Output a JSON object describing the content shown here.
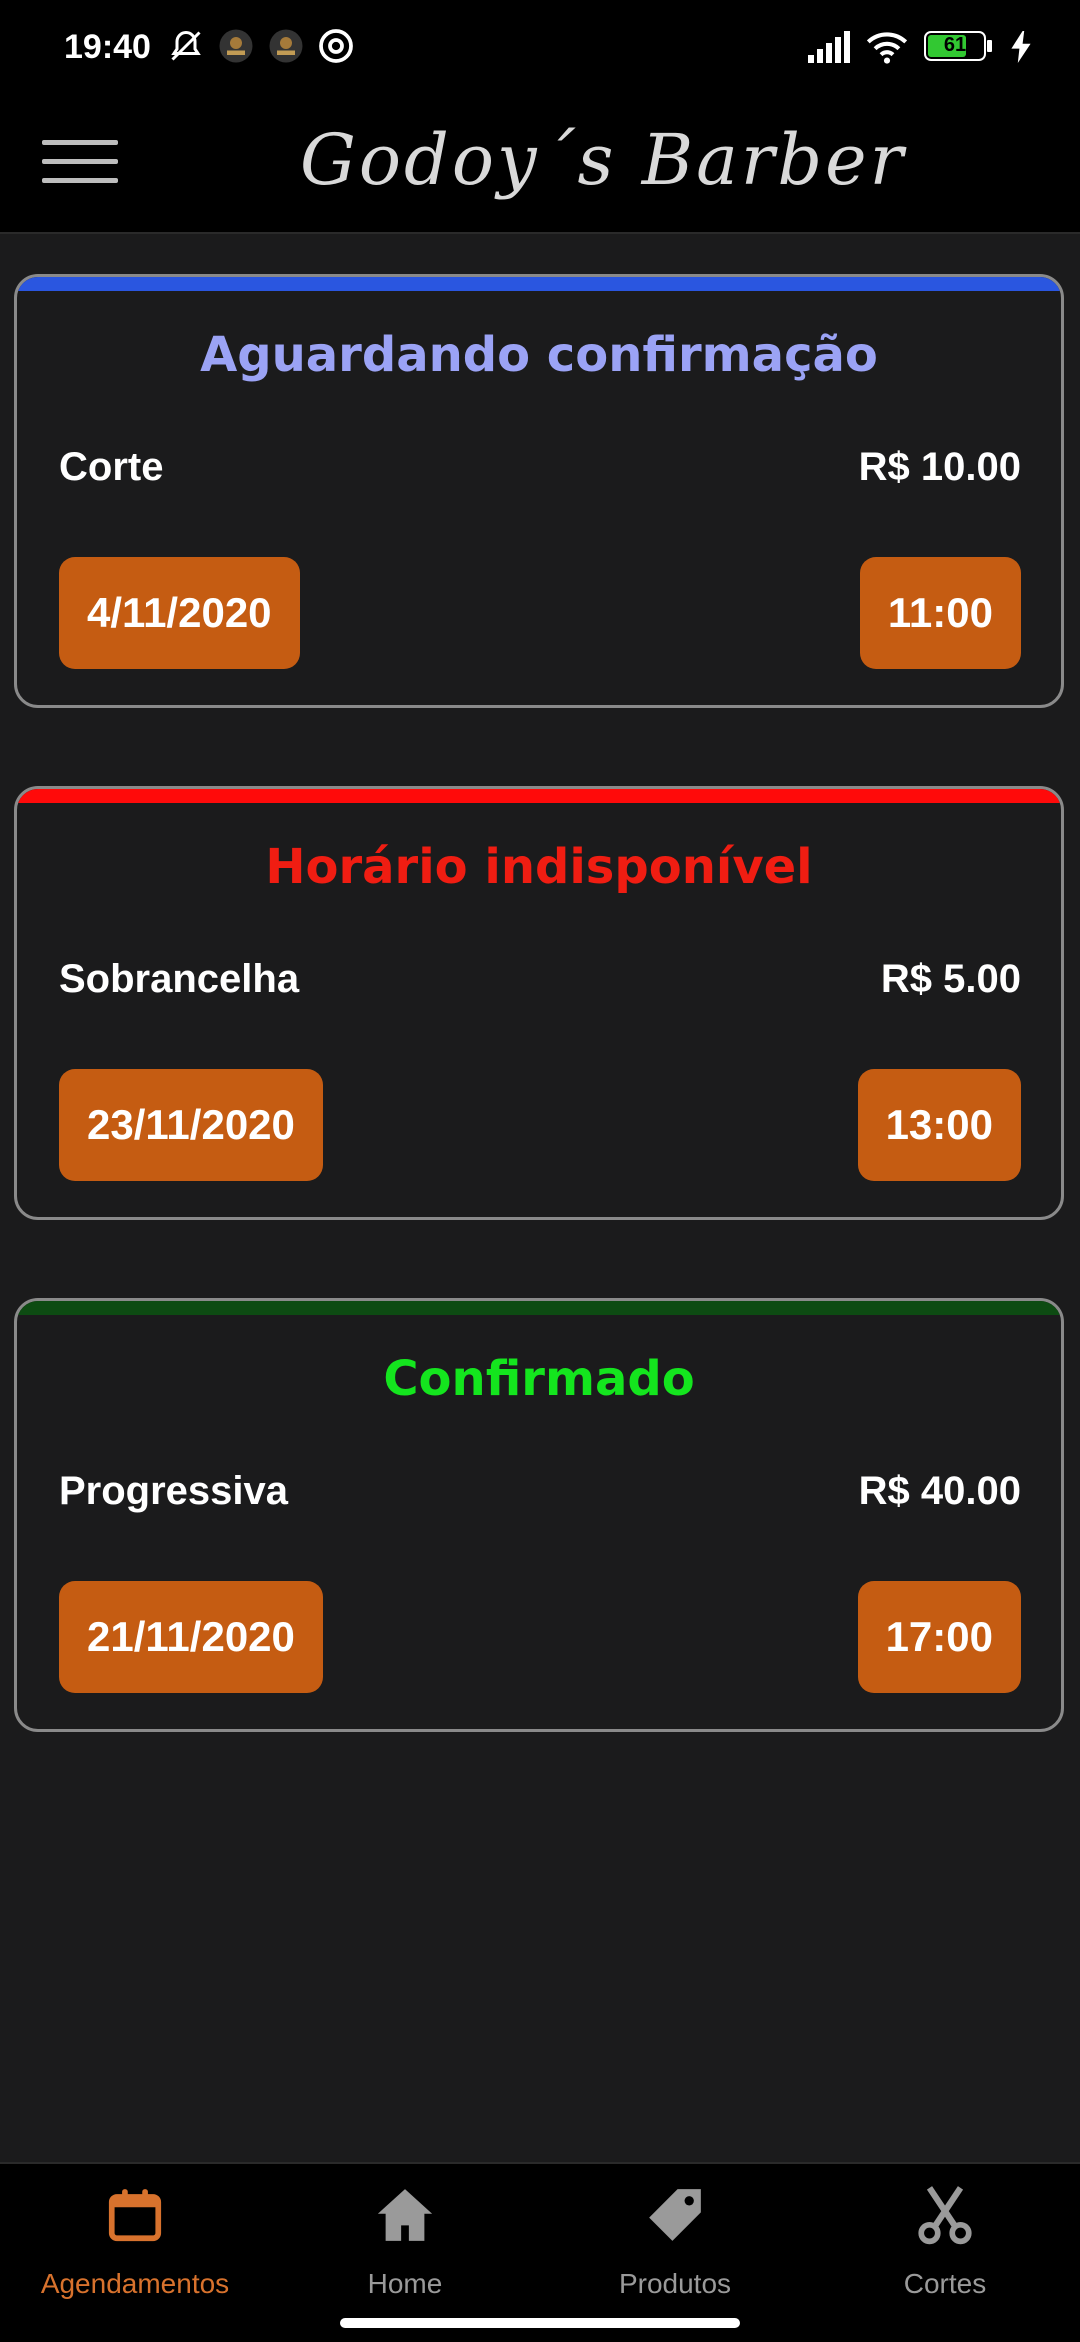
{
  "status_bar": {
    "time": "19:40",
    "battery": "61"
  },
  "header": {
    "brand": "Godoy´s Barber",
    "menu_icon": "hamburger-menu-icon"
  },
  "appointments": [
    {
      "status": "Aguardando confirmação",
      "status_color": "#9ba3f5",
      "accent_color": "#2a56e0",
      "service": "Corte",
      "price": "R$ 10.00",
      "date": "4/11/2020",
      "time": "11:00"
    },
    {
      "status": "Horário indisponível",
      "status_color": "#f01d12",
      "accent_color": "#ff0a0a",
      "service": "Sobrancelha",
      "price": "R$ 5.00",
      "date": "23/11/2020",
      "time": "13:00"
    },
    {
      "status": "Confirmado",
      "status_color": "#14e51e",
      "accent_color": "#0d4b12",
      "service": "Progressiva",
      "price": "R$ 40.00",
      "date": "21/11/2020",
      "time": "17:00"
    }
  ],
  "bottom_nav": {
    "active_color": "#d8722d",
    "inactive_color": "#9a9a9a",
    "items": [
      {
        "label": "Agendamentos",
        "icon": "calendar-icon",
        "active": true
      },
      {
        "label": "Home",
        "icon": "home-icon",
        "active": false
      },
      {
        "label": "Produtos",
        "icon": "tag-icon",
        "active": false
      },
      {
        "label": "Cortes",
        "icon": "scissors-icon",
        "active": false
      }
    ]
  }
}
